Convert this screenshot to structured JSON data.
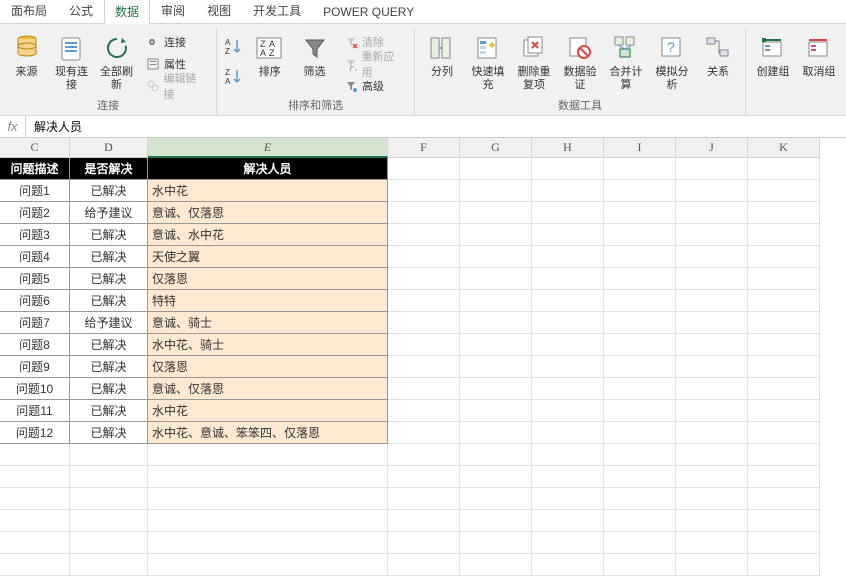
{
  "tabs": {
    "t0": "面布局",
    "t1": "公式",
    "t2": "数据",
    "t3": "审阅",
    "t4": "视图",
    "t5": "开发工具",
    "t6": "POWER QUERY"
  },
  "ribbon": {
    "source": "来源",
    "existing_conn": "现有连接",
    "refresh_all": "全部刷新",
    "connections": "连接",
    "properties": "属性",
    "edit_links": "编辑链接",
    "group_conn": "连接",
    "sort": "排序",
    "filter": "筛选",
    "clear": "清除",
    "reapply": "重新应用",
    "advanced": "高级",
    "group_sort": "排序和筛选",
    "text_to_cols": "分列",
    "flash_fill": "快速填充",
    "remove_dup": "删除重复项",
    "data_val": "数据验证",
    "consolidate": "合并计算",
    "whatif": "模拟分析",
    "relationships": "关系",
    "group_data": "数据工具",
    "create_group": "创建组",
    "ungroup": "取消组"
  },
  "formula": {
    "fx": "fx",
    "value": "解决人员"
  },
  "columns": {
    "C": "C",
    "D": "D",
    "E": "E",
    "F": "F",
    "G": "G",
    "H": "H",
    "I": "I",
    "J": "J",
    "K": "K"
  },
  "headers": {
    "c": "问题描述",
    "d": "是否解决",
    "e": "解决人员"
  },
  "rows": [
    {
      "c": "问题1",
      "d": "已解决",
      "e": "水中花"
    },
    {
      "c": "问题2",
      "d": "给予建议",
      "e": "意诚、仅落恩"
    },
    {
      "c": "问题3",
      "d": "已解决",
      "e": "意诚、水中花"
    },
    {
      "c": "问题4",
      "d": "已解决",
      "e": "天使之翼"
    },
    {
      "c": "问题5",
      "d": "已解决",
      "e": "仅落恩"
    },
    {
      "c": "问题6",
      "d": "已解决",
      "e": "特特"
    },
    {
      "c": "问题7",
      "d": "给予建议",
      "e": "意诚、骑士"
    },
    {
      "c": "问题8",
      "d": "已解决",
      "e": "水中花、骑士"
    },
    {
      "c": "问题9",
      "d": "已解决",
      "e": "仅落恩"
    },
    {
      "c": "问题10",
      "d": "已解决",
      "e": "意诚、仅落恩"
    },
    {
      "c": "问题11",
      "d": "已解决",
      "e": "水中花"
    },
    {
      "c": "问题12",
      "d": "已解决",
      "e": "水中花、意诚、笨笨四、仅落恩"
    }
  ]
}
